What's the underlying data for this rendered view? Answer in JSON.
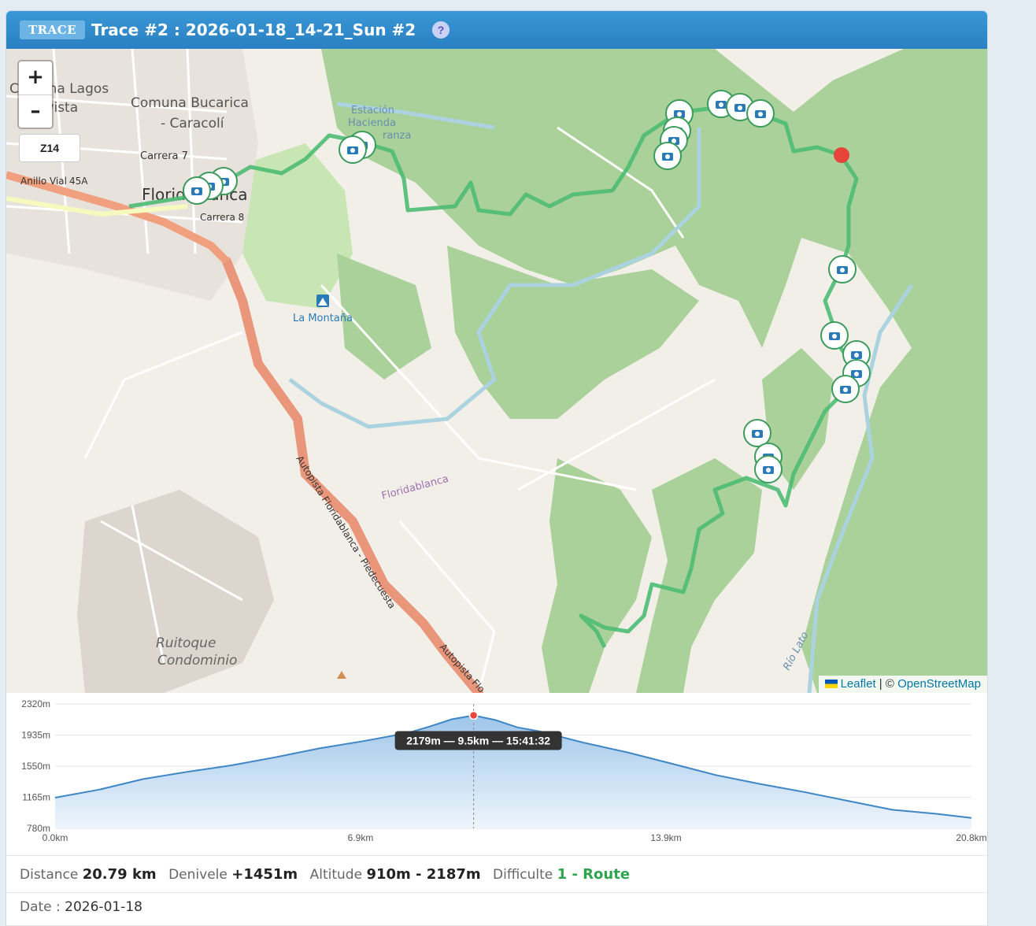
{
  "header": {
    "badge": "TRACE",
    "title": "Trace #2 : 2026-01-18_14-21_Sun #2",
    "help": "?"
  },
  "map": {
    "zoom_in": "+",
    "zoom_out": "–",
    "zoom_level": "Z14",
    "attribution_leaflet": "Leaflet",
    "attribution_sep": " | © ",
    "attribution_osm": "OpenStreetMap",
    "labels": {
      "comuna_lagos": "Comuna Lagos",
      "bellavista": "avista",
      "bucarica": "Comuna Bucarica",
      "caracoli": "- Caracolí",
      "carrera7": "Carrera 7",
      "anillo_vial": "Anillo Vial",
      "road45a": "45A",
      "floridablanca_city": "Floridablanca",
      "carrera8": "Carrera 8",
      "estacion": "Estación",
      "hacienda": "Hacienda",
      "esperanza": "ranza",
      "la_montana": "La Montaña",
      "autopista": "Autopista Floridablanca - Piedecuesta",
      "autopista2": "Autopista Flo",
      "floridablanca_area": "Floridablanca",
      "ruitoque": "Ruitoque",
      "condominio": "Condominio",
      "rio_lato": "Río Lato"
    },
    "colors": {
      "track": "#4cbb73",
      "forest": "#a9d199",
      "park": "#c8e6b4",
      "river": "#aad3df",
      "motorway": "#e9967a",
      "trunk": "#f7fabf",
      "endpoint": "#e8443a"
    },
    "icons": [
      "camera-icon",
      "park-icon",
      "peak-icon"
    ]
  },
  "elevation": {
    "y_ticks": [
      "2320m",
      "1935m",
      "1550m",
      "1165m",
      "780m"
    ],
    "x_ticks": [
      "0.0km",
      "6.9km",
      "13.9km",
      "20.8km"
    ],
    "tooltip": "2179m — 9.5km — 15:41:32",
    "chart_data": {
      "type": "area",
      "xlabel": "",
      "ylabel": "",
      "x": [
        0,
        1,
        2,
        3,
        4,
        5,
        6,
        7,
        8,
        8.5,
        9,
        9.5,
        10,
        10.5,
        11,
        12,
        13,
        14,
        15,
        16,
        17,
        18,
        19,
        20,
        20.8
      ],
      "y": [
        1160,
        1260,
        1390,
        1480,
        1560,
        1660,
        1770,
        1860,
        1960,
        2040,
        2130,
        2179,
        2120,
        2030,
        1980,
        1840,
        1720,
        1580,
        1440,
        1330,
        1230,
        1120,
        1010,
        960,
        910
      ],
      "xlim": [
        0,
        20.8
      ],
      "ylim": [
        780,
        2320
      ],
      "marker": {
        "x": 9.5,
        "y": 2179,
        "time": "15:41:32"
      }
    }
  },
  "stats": {
    "distance_label": "Distance",
    "distance": "20.79 km",
    "denivele_label": "Denivele",
    "denivele": "+1451m",
    "altitude_label": "Altitude",
    "altitude": "910m - 2187m",
    "difficulte_label": "Difficulte",
    "difficulte": "1 - Route"
  },
  "date": {
    "label": "Date :",
    "value": "2026-01-18"
  }
}
